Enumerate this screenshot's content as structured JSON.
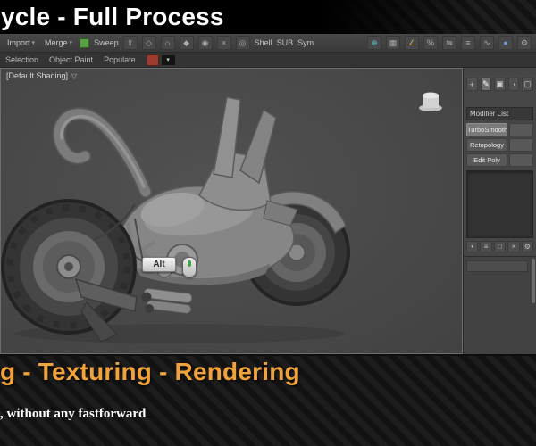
{
  "banner": {
    "top_title": "ycle - Full Process",
    "bottom_title": "g - Texturing - Rendering",
    "bottom_subtitle": ", without any fastforward"
  },
  "colors": {
    "accent_orange": "#F1A33B",
    "keycast_green": "#46a04a",
    "toolbar_green_chip": "#58a044",
    "red_swatch": "#9c3b32"
  },
  "toolbar": {
    "menu_import": "Import",
    "menu_merge": "Merge",
    "sweep": "Sweep",
    "shell": "Shell",
    "sub": "SUB",
    "sym": "Sym",
    "tab_selection": "Selection",
    "tab_object_paint": "Object Paint",
    "tab_populate": "Populate"
  },
  "viewport": {
    "shading_label": "[Default Shading]",
    "keycast_key": "Alt"
  },
  "command_panel": {
    "modifier_list": "Modifier List",
    "buttons": [
      "TurboSmooth",
      "Retopology",
      "Edit Poly"
    ]
  },
  "icon_glyphs": {
    "dropdown": "▾",
    "extrude": "⇧",
    "bevel": "◇",
    "bridge": "∩",
    "chamfer": "◆",
    "weld": "◉",
    "cut": "×",
    "loop": "◎",
    "snaps_toggle": "⊕",
    "grid": "▦",
    "angle_snap": "∠",
    "percent_snap": "%",
    "mirror": "⇋",
    "layers": "≡",
    "curve_editor": "∿",
    "material_editor": "●",
    "create": "+",
    "modify": "✎",
    "hierarchy": "▣",
    "motion": "◔",
    "display": "▢",
    "funnel": "▽",
    "pin": "•",
    "show_end_result": "≡",
    "make_unique": "□",
    "remove": "×",
    "configure": "⚙"
  }
}
